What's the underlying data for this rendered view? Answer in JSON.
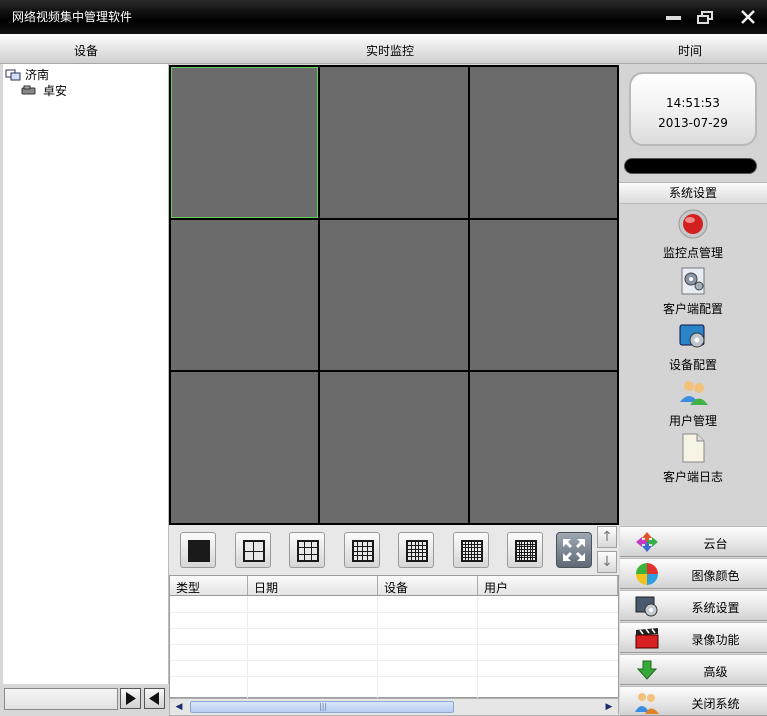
{
  "window": {
    "title": "网络视频集中管理软件",
    "controls": [
      "minimize",
      "restore",
      "close"
    ]
  },
  "header": {
    "device_label": "设备",
    "monitor_label": "实时监控",
    "time_label": "时间"
  },
  "tree": {
    "root": {
      "label": "济南",
      "icon": "network-group-icon"
    },
    "children": [
      {
        "label": "卓安",
        "icon": "camera-device-icon"
      }
    ]
  },
  "video_grid": {
    "rows": 3,
    "cols": 3,
    "selected_cell": 1
  },
  "layout_options": [
    "1x1",
    "2x2",
    "3x3",
    "4x4",
    "5x5",
    "6x6",
    "7x7"
  ],
  "log_table": {
    "columns": [
      "类型",
      "日期",
      "设备",
      "用户"
    ],
    "rows": []
  },
  "clock": {
    "time": "14:51:53",
    "date": "2013-07-29"
  },
  "settings": {
    "title": "系统设置",
    "items": [
      {
        "label": "监控点管理",
        "icon": "red-button-icon"
      },
      {
        "label": "客户端配置",
        "icon": "gears-icon"
      },
      {
        "label": "设备配置",
        "icon": "device-gears-icon"
      },
      {
        "label": "用户管理",
        "icon": "users-icon"
      },
      {
        "label": "客户端日志",
        "icon": "document-icon"
      }
    ]
  },
  "menu": [
    {
      "label": "云台",
      "icon": "ptz-icon"
    },
    {
      "label": "图像颜色",
      "icon": "color-wheel-icon"
    },
    {
      "label": "系统设置",
      "icon": "settings-icon"
    },
    {
      "label": "录像功能",
      "icon": "clapper-icon"
    },
    {
      "label": "高级",
      "icon": "down-arrow-icon"
    },
    {
      "label": "关闭系统",
      "icon": "users-exit-icon"
    }
  ],
  "colors": {
    "cell": "#6b6b6b",
    "selected_border": "#5dd35d",
    "titlebar": "#000000"
  }
}
